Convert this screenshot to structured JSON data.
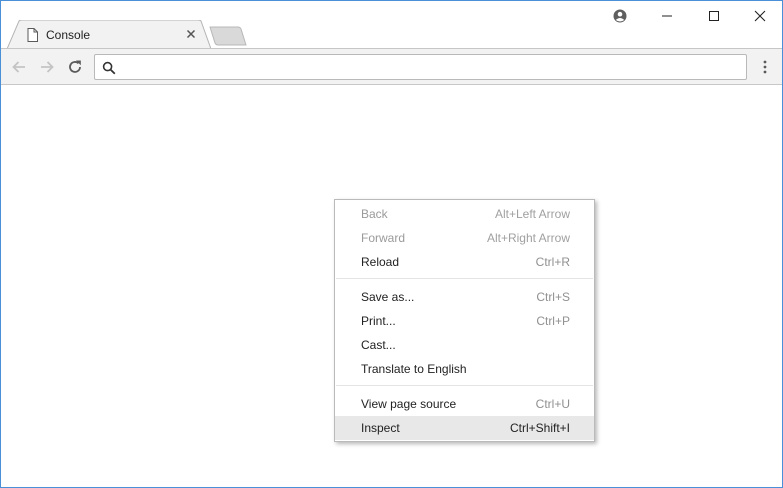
{
  "tab": {
    "title": "Console"
  },
  "omnibox": {
    "value": "",
    "placeholder": ""
  },
  "context_menu": {
    "groups": [
      [
        {
          "label": "Back",
          "shortcut": "Alt+Left Arrow",
          "enabled": false
        },
        {
          "label": "Forward",
          "shortcut": "Alt+Right Arrow",
          "enabled": false
        },
        {
          "label": "Reload",
          "shortcut": "Ctrl+R",
          "enabled": true
        }
      ],
      [
        {
          "label": "Save as...",
          "shortcut": "Ctrl+S",
          "enabled": true
        },
        {
          "label": "Print...",
          "shortcut": "Ctrl+P",
          "enabled": true
        },
        {
          "label": "Cast...",
          "shortcut": "",
          "enabled": true
        },
        {
          "label": "Translate to English",
          "shortcut": "",
          "enabled": true
        }
      ],
      [
        {
          "label": "View page source",
          "shortcut": "Ctrl+U",
          "enabled": true
        },
        {
          "label": "Inspect",
          "shortcut": "Ctrl+Shift+I",
          "enabled": true,
          "highlighted": true
        }
      ]
    ]
  },
  "icons": {
    "tab": [
      "document-icon",
      "close-icon"
    ],
    "window": [
      "profile-icon",
      "minimize-icon",
      "maximize-icon",
      "close-icon"
    ],
    "toolbar": [
      "back-arrow-icon",
      "forward-arrow-icon",
      "reload-icon",
      "search-icon",
      "more-vert-icon"
    ]
  },
  "colors": {
    "window_border": "#4a90d9",
    "toolbar_bg": "#f2f2f2",
    "menu_highlight": "#e8e8e8",
    "disabled_text": "#9a9a9a"
  }
}
